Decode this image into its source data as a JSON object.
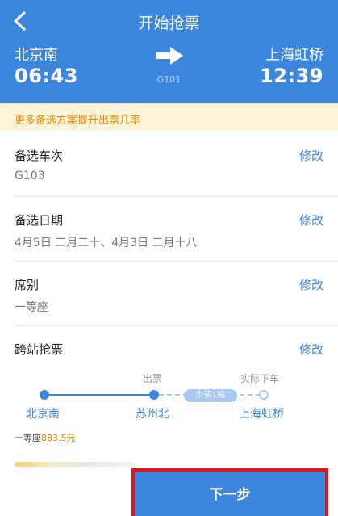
{
  "header": {
    "title": "开始抢票",
    "from_station": "北京南",
    "to_station": "上海虹桥",
    "departure_time": "06:43",
    "arrival_time": "12:39",
    "train_code": "G101"
  },
  "tip": "更多备选方案提升出票几率",
  "rows": [
    {
      "label": "备选车次",
      "value": "G103",
      "edit": "修改"
    },
    {
      "label": "备选日期",
      "value": "4月5日 二月二十、4月3日 二月十八",
      "edit": "修改"
    },
    {
      "label": "席别",
      "value": "一等座",
      "edit": "修改"
    },
    {
      "label": "跨站抢票",
      "edit": "修改"
    }
  ],
  "route": {
    "ticket_label": "出票",
    "actual_alight_label": "实际下车",
    "extra_stop_pill": "少买1站",
    "stations": [
      "北京南",
      "苏州北",
      "上海虹桥"
    ]
  },
  "seat": {
    "class": "一等座",
    "price": "883.5元"
  },
  "next_button": "下一步",
  "colors": {
    "primary": "#3c86dd",
    "tip_bg": "#fff4d9",
    "tip_text": "#e58a00",
    "highlight_border": "#e0161e"
  }
}
